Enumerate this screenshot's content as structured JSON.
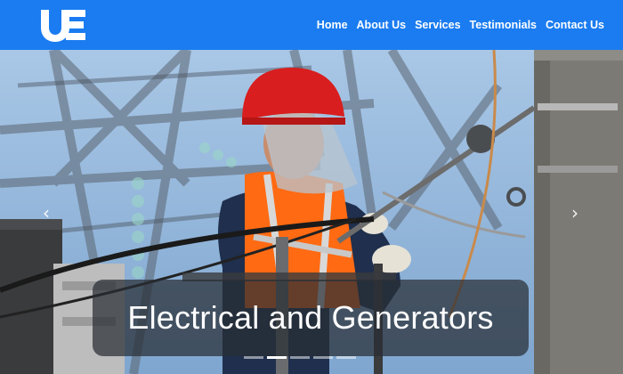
{
  "brand": {
    "logo_text": "UE"
  },
  "nav": {
    "items": [
      {
        "label": "Home"
      },
      {
        "label": "About Us"
      },
      {
        "label": "Services"
      },
      {
        "label": "Testimonials"
      },
      {
        "label": "Contact Us"
      }
    ]
  },
  "carousel": {
    "caption": "Electrical and Generators",
    "prev_icon": "chevron-left-icon",
    "next_icon": "chevron-right-icon",
    "prev_glyph": "‹",
    "next_glyph": "›",
    "slide_count": 5,
    "active_slide": 2
  },
  "colors": {
    "navbar": "#1a7cf0",
    "helmet": "#d81e1e",
    "vest": "#ff6a13",
    "sky": "#8fb6de"
  }
}
